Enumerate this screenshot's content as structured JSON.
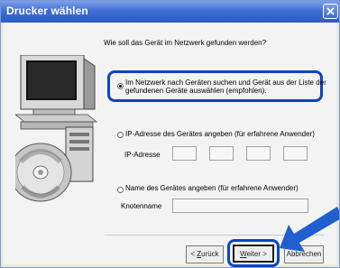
{
  "window": {
    "title": "Drucker wählen"
  },
  "question": "Wie soll das Gerät im Netzwerk gefunden werden?",
  "options": {
    "search": {
      "line1": "Im Netzwerk nach Geräten suchen und Gerät aus der Liste der",
      "line2": "gefundenen Geräte auswählen (empfohlen).",
      "checked": true
    },
    "ip": {
      "label": "IP-Adresse des Gerätes angeben (für erfahrene Anwender)",
      "field_label": "IP-Adresse",
      "octets": [
        "",
        "",
        "",
        ""
      ]
    },
    "name": {
      "label": "Name des Gerätes angeben (für erfahrene Anwender)",
      "field_label": "Knotenname",
      "value": ""
    }
  },
  "buttons": {
    "back_prefix": "< ",
    "back_accel": "Z",
    "back_rest": "urück",
    "next_accel": "W",
    "next_rest": "eiter >",
    "cancel": "Abbrechen"
  },
  "colors": {
    "highlight": "#0a44c9",
    "arrow": "#1f5fd0"
  },
  "icons": [
    "close-icon",
    "computer-illustration",
    "cd-disc-illustration",
    "pointer-arrow"
  ]
}
